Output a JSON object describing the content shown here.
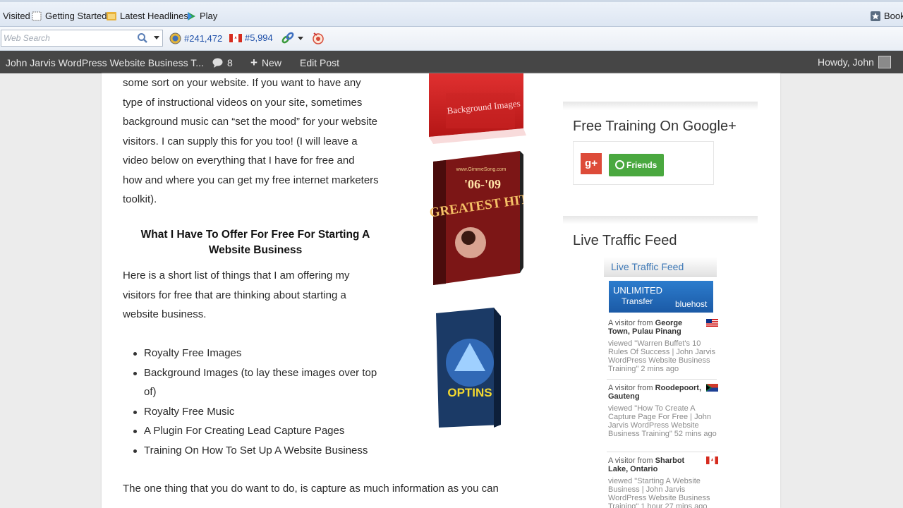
{
  "bookmarks": {
    "items": [
      {
        "label": "Visited"
      },
      {
        "label": "Getting Started"
      },
      {
        "label": "Latest Headlines"
      },
      {
        "label": "Play"
      }
    ],
    "right_label": "Book"
  },
  "toolbar": {
    "search_placeholder": "Web Search",
    "rank_global": "#241,472",
    "rank_country": "#5,994"
  },
  "adminbar": {
    "site_title": "John Jarvis WordPress Website Business T...",
    "comments_count": "8",
    "new_label": "New",
    "edit_label": "Edit Post",
    "howdy": "Howdy, John"
  },
  "article": {
    "intro_lines": [
      "some sort on your website. If you want to have any",
      "type of instructional videos on your site, sometimes",
      "background music can “set the mood” for your website",
      "visitors. I can supply this for you too! (I will leave a",
      "video below on everything that I have for free and",
      "how and where you can get my free internet marketers",
      "toolkit)."
    ],
    "heading": "What I Have To Offer For Free For Starting A Website Business",
    "list_intro_lines": [
      "Here is a short list of things that I am offering my",
      "visitors for free that are thinking about starting a",
      "website business."
    ],
    "list": [
      "Royalty Free Images",
      "Background Images (to lay these images over top of)",
      "Royalty Free Music",
      "A Plugin For Creating Lead Capture Pages",
      "Training On How To Set Up A Website Business"
    ],
    "closing_line": "The one thing that you do want to do, is capture as much information as you can",
    "product_labels": {
      "background": "Background Images",
      "hits_top": "'06-'09",
      "hits_main": "GREATEST HITS",
      "hits_url": "www.GimmeSong.com",
      "optins": "OPTINS"
    }
  },
  "sidebar": {
    "google_title": "Free Training On Google+",
    "friends_label": "Friends",
    "traffic_title": "Live Traffic Feed",
    "feed_header": "Live Traffic Feed",
    "bluehost_line1": "UNLIMITED",
    "bluehost_line2": "Transfer",
    "bluehost_brand": "bluehost",
    "visitors": [
      {
        "prefix": "A visitor from",
        "place": "George Town, Pulau Pinang",
        "viewed": "viewed \"Warren Buffet's 10 Rules Of Success | John Jarvis WordPress Website Business Training\"",
        "ago": "2 mins ago"
      },
      {
        "prefix": "A visitor from",
        "place": "Roodepoort, Gauteng",
        "viewed": "viewed \"How To Create A Capture Page For Free | John Jarvis WordPress Website Business Training\"",
        "ago": "52 mins ago"
      },
      {
        "prefix": "A visitor from",
        "place": "Sharbot Lake, Ontario",
        "viewed": "viewed \"Starting A Website Business | John Jarvis WordPress Website Business Training\"",
        "ago": "1 hour 27 mins ago"
      }
    ]
  }
}
